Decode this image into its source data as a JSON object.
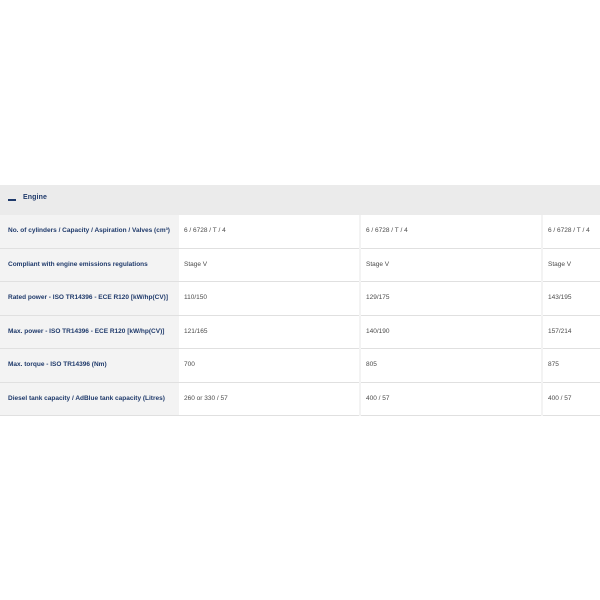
{
  "section": {
    "title": "Engine",
    "icon": "minus-icon"
  },
  "rows": [
    {
      "label": "No. of cylinders / Capacity / Aspiration / Valves (cm³)",
      "values": [
        "6 / 6728 / T / 4",
        "6 / 6728 / T / 4",
        "6 / 6728 / T / 4"
      ]
    },
    {
      "label": "Compliant with engine emissions regulations",
      "values": [
        "Stage V",
        "Stage V",
        "Stage V"
      ]
    },
    {
      "label": "Rated power - ISO TR14396 - ECE R120 [kW/hp(CV)]",
      "values": [
        "110/150",
        "129/175",
        "143/195"
      ]
    },
    {
      "label": "Max. power - ISO TR14396 - ECE R120 [kW/hp(CV)]",
      "values": [
        "121/165",
        "140/190",
        "157/214"
      ]
    },
    {
      "label": "Max. torque - ISO TR14396 (Nm)",
      "values": [
        "700",
        "805",
        "875"
      ]
    },
    {
      "label": "Diesel tank capacity / AdBlue tank capacity (Litres)",
      "values": [
        "260 or 330 / 57",
        "400 / 57",
        "400 / 57"
      ]
    }
  ],
  "colors": {
    "header_bg": "#ebebeb",
    "label_bg": "#f3f3f3",
    "label_text": "#1f3a6b",
    "value_text": "#4a4a4a"
  }
}
